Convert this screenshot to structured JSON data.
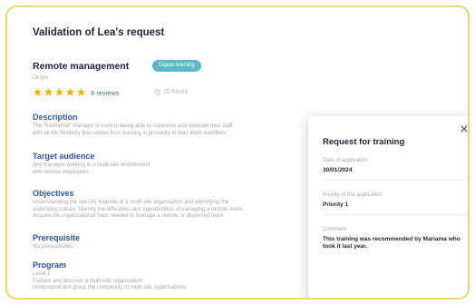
{
  "header": {
    "title": "Validation of Lea's request"
  },
  "course": {
    "title": "Remote management",
    "provider": "Orsys",
    "badge": "Digital learning",
    "rating": 5,
    "reviews": "8 reviews",
    "duration": "20 hours"
  },
  "sections": [
    {
      "title": "Description",
      "lines": [
        "The \"traditional\" manager is used to being able to supervise and motivate their staff",
        "with all the flexibility that comes from working in proximity to their team members"
      ]
    },
    {
      "title": "Target audience",
      "lines": [
        "Any manager working in a multi-site environment",
        "with remote employees"
      ]
    },
    {
      "title": "Objectives",
      "lines": [
        "Understanding the specific features of a multi-site organisation and identifying the",
        "underlying culture. Identify the difficulties and opportunities of managing a remote team.",
        "Acquire the organizational tools needed to manage a remote or dispersed team"
      ]
    },
    {
      "title": "Prerequisite",
      "lines": [
        "No prerequisites."
      ]
    },
    {
      "title": "Program",
      "lines": [
        "Level 1",
        "Explore and discover a multi-site organisation",
        "Understand and grasp the complexity of multi-site organisations"
      ]
    }
  ],
  "panel": {
    "title": "Request for training",
    "fields": [
      {
        "label": "Date of application",
        "value": "30/01/2024"
      },
      {
        "label": "Priority of the application",
        "value": "Priority 1"
      },
      {
        "label": "Comment",
        "value": "This training was recommended by Mariama who took it last year."
      }
    ]
  },
  "colors": {
    "accent": "#2f56a3",
    "badge": "#59b8c8",
    "star": "#f5b400",
    "frame": "#f3d36a"
  },
  "icons": {
    "close": "close-icon",
    "star": "star-icon",
    "clock": "clock-icon"
  }
}
